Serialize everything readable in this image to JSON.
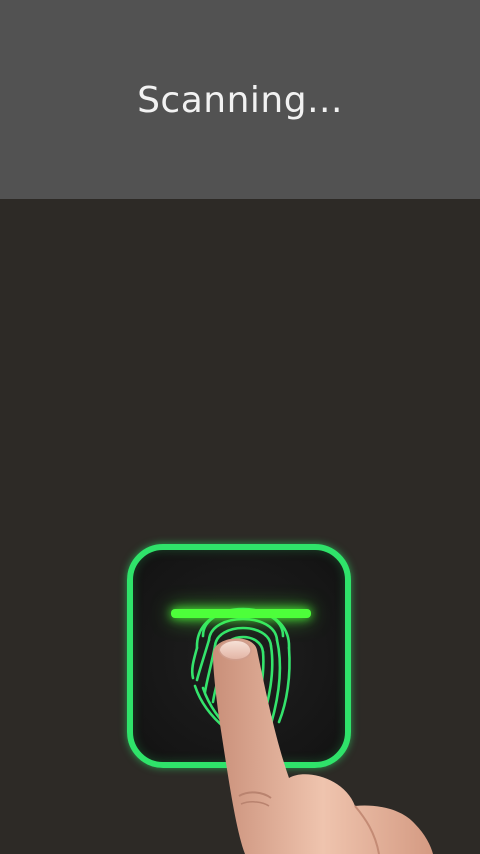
{
  "header": {
    "title": "Scanning..."
  },
  "scanner": {
    "accent_color": "#2fe36a",
    "scan_line_color": "#4dff3a",
    "icon": "fingerprint-icon",
    "state": "scanning"
  }
}
